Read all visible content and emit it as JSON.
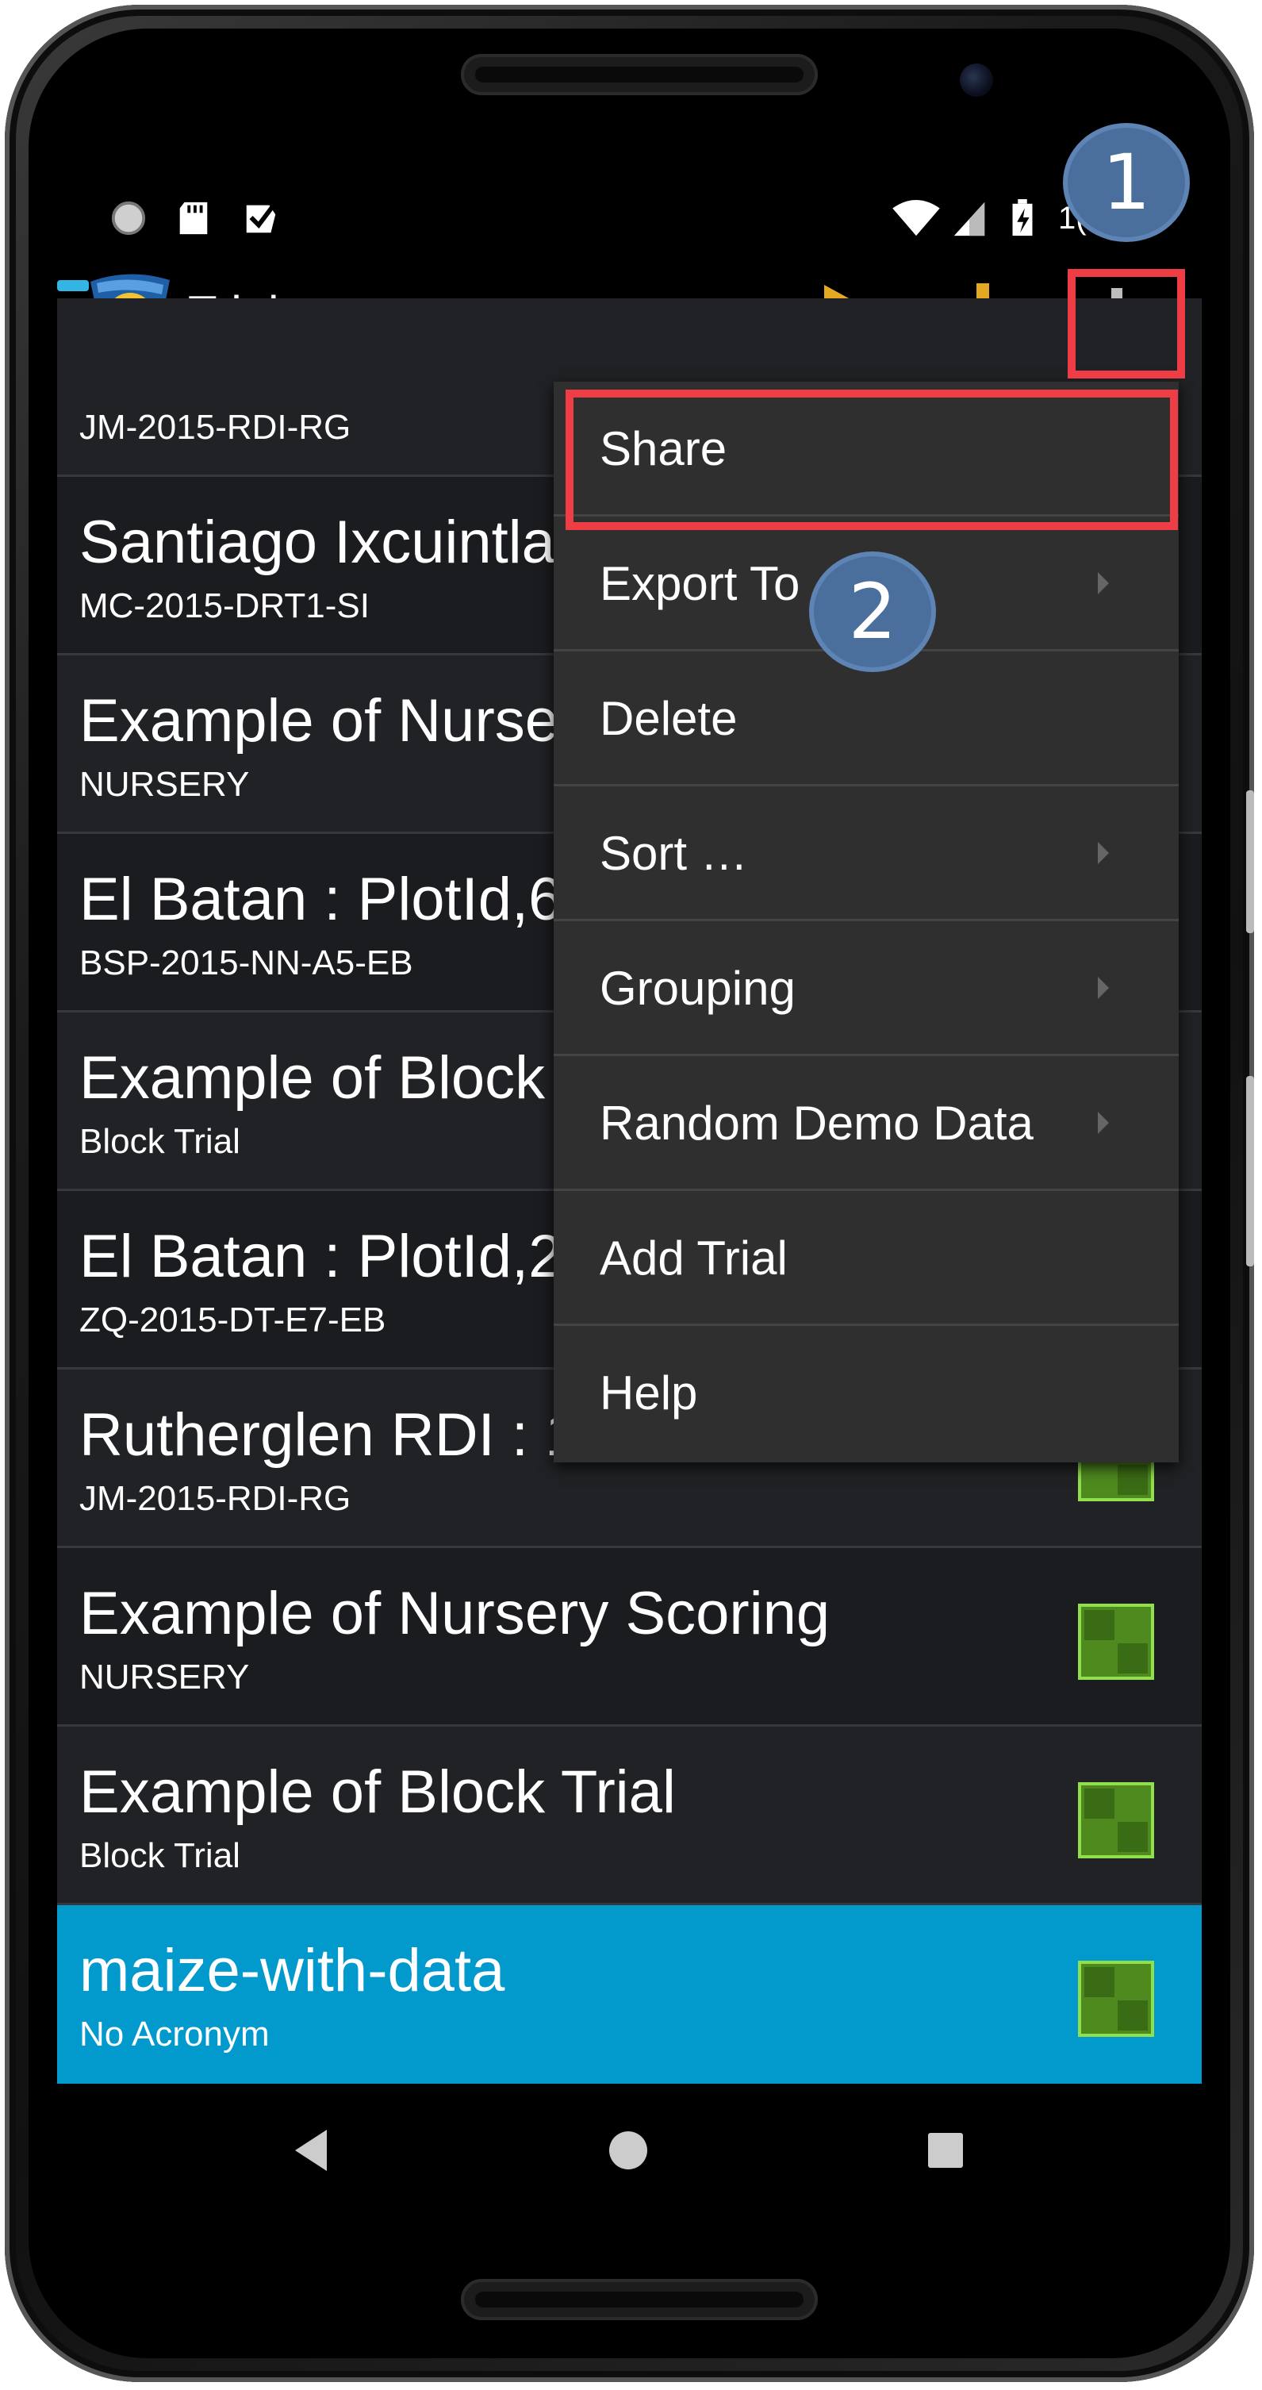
{
  "status_bar": {
    "clock_partial": "1(",
    "icons": [
      "spinner-icon",
      "sd-card-icon",
      "checkbox-notification-icon",
      "wifi-icon",
      "signal-icon",
      "battery-charging-icon"
    ]
  },
  "action_bar": {
    "title": "Trials",
    "accent_color": "#33b5e5",
    "actions": [
      "play-icon",
      "download-icon",
      "overflow-menu-icon"
    ]
  },
  "trials": [
    {
      "title": "",
      "subtitle": "JM-2015-RDI-RG"
    },
    {
      "title": "Santiago Ixcuintla",
      "subtitle": "MC-2015-DRT1-SI"
    },
    {
      "title": "Example of Nurse",
      "subtitle": "NURSERY"
    },
    {
      "title": "El Batan : PlotId,6",
      "subtitle": "BSP-2015-NN-A5-EB"
    },
    {
      "title": "Example of Block",
      "subtitle": "Block Trial"
    },
    {
      "title": "El Batan : PlotId,2",
      "subtitle": "ZQ-2015-DT-E7-EB"
    },
    {
      "title": "Rutherglen RDI : 1",
      "subtitle": "JM-2015-RDI-RG"
    },
    {
      "title": "Example of Nursery Scoring",
      "subtitle": "NURSERY"
    },
    {
      "title": "Example of Block Trial",
      "subtitle": "Block Trial"
    },
    {
      "title": "maize-with-data",
      "subtitle": "No Acronym",
      "selected": true
    }
  ],
  "overflow_menu": {
    "items": [
      {
        "label": "Share",
        "submenu": false
      },
      {
        "label": "Export To",
        "submenu": true
      },
      {
        "label": "Delete",
        "submenu": false
      },
      {
        "label": "Sort …",
        "submenu": true
      },
      {
        "label": "Grouping",
        "submenu": true
      },
      {
        "label": "Random Demo Data",
        "submenu": true
      },
      {
        "label": "Add Trial",
        "submenu": false
      },
      {
        "label": "Help",
        "submenu": false
      }
    ]
  },
  "annotations": {
    "callout_1": "1",
    "callout_2": "2",
    "highlight_color": "#ee3d44",
    "callout_color": "#4a6f9c"
  },
  "nav_bar": {
    "buttons": [
      "back-icon",
      "home-icon",
      "recents-icon"
    ]
  },
  "colors": {
    "selected_row": "#0299cc",
    "play_icon": "#e5a823",
    "download_icon": "#e5a823",
    "trial_icon_green": "#4f8a1f"
  }
}
